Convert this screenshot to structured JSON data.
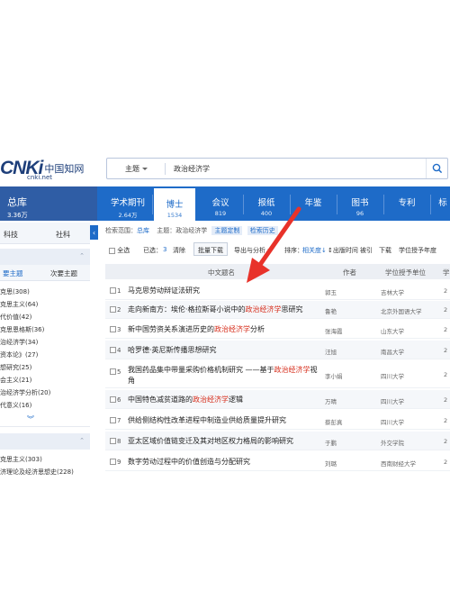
{
  "header": {
    "logo_text": "CNKi",
    "logo_cn": "中国知网",
    "logo_url": "cnki.net",
    "search_field": "主题",
    "search_value": "政治经济学"
  },
  "zongku": {
    "title": "总库",
    "count": "3.36万"
  },
  "nav_tabs": [
    {
      "label": "学术期刊",
      "count": "2.64万"
    },
    {
      "label": "博士",
      "count": "1534"
    },
    {
      "label": "会议",
      "count": "819"
    },
    {
      "label": "报纸",
      "count": "400"
    },
    {
      "label": "年鉴",
      "count": ""
    },
    {
      "label": "图书",
      "count": "96"
    },
    {
      "label": "专利",
      "count": ""
    },
    {
      "label": "标",
      "count": ""
    }
  ],
  "left": {
    "tabs": [
      "科技",
      "社科"
    ],
    "panel1_tabs": [
      "要主题",
      "次要主题"
    ],
    "panel1_items": [
      "克思(308)",
      "克思主义(64)",
      "代价值(42)",
      "克思恩格斯(36)",
      "治经济学(34)",
      "资本论》(27)",
      "想研究(25)",
      "会主义(21)",
      "治经济学分析(20)",
      "代意义(16)"
    ],
    "more_icon": "chevron-double-down",
    "panel2_items": [
      "克思主义(303)",
      "济理论及经济思想史(228)"
    ]
  },
  "results": {
    "scope_label": "检索范围：",
    "scope_value": "总库",
    "topic_label": "主题：",
    "topic_value": "政治经济学",
    "tag_custom": "主题定制",
    "tag_history": "检索历史",
    "select_all": "全选",
    "selected_label": "已选：",
    "selected_count": "3",
    "clear": "清除",
    "bulk_download": "批量下载",
    "export": "导出与分析",
    "sort_label": "排序：",
    "sort_relevance": "相关度",
    "sort_date": "出版时间",
    "sort_cited": "被引",
    "sort_download": "下载",
    "sort_unit": "学位授予年度"
  },
  "table": {
    "columns": [
      "中文题名",
      "作者",
      "学位授予单位",
      "学"
    ],
    "rows": [
      {
        "num": "1",
        "title_pre": "马克思劳动辩证法研究",
        "hl": "",
        "title_post": "",
        "author": "郭玉",
        "unit": "吉林大学",
        "extra": "2"
      },
      {
        "num": "2",
        "title_pre": "走向新南方：埃伦·格拉斯哥小说中的",
        "hl": "政治经济学",
        "title_post": "思研究",
        "author": "鲁艳",
        "unit": "北京外国语大学",
        "extra": "2"
      },
      {
        "num": "3",
        "title_pre": "新中国劳资关系演进历史的",
        "hl": "政治经济学",
        "title_post": "分析",
        "author": "张海霞",
        "unit": "山东大学",
        "extra": "2"
      },
      {
        "num": "4",
        "title_pre": "哈罗德·英尼斯传播思想研究",
        "hl": "",
        "title_post": "",
        "author": "汪旭",
        "unit": "南昌大学",
        "extra": "2"
      },
      {
        "num": "5",
        "title_pre": "我国药品集中带量采购价格机制研究 ——基于",
        "hl": "政治经济学",
        "title_post": "视角",
        "author": "李小娟",
        "unit": "四川大学",
        "extra": "2"
      },
      {
        "num": "6",
        "title_pre": "中国特色减贫道路的",
        "hl": "政治经济学",
        "title_post": "逻辑",
        "author": "万晴",
        "unit": "四川大学",
        "extra": "2"
      },
      {
        "num": "7",
        "title_pre": "供给侧结构性改革进程中制造业供给质量提升研究",
        "hl": "",
        "title_post": "",
        "author": "蔡彭真",
        "unit": "四川大学",
        "extra": "2"
      },
      {
        "num": "8",
        "title_pre": "亚太区域价值链变迁及其对地区权力格局的影响研究",
        "hl": "",
        "title_post": "",
        "author": "于鹏",
        "unit": "外交学院",
        "extra": "2"
      },
      {
        "num": "9",
        "title_pre": "数字劳动过程中的价值创造与分配研究",
        "hl": "",
        "title_post": "",
        "author": "刘璐",
        "unit": "西南财经大学",
        "extra": "2"
      }
    ]
  },
  "colors": {
    "brand_blue": "#1e6bc8",
    "highlight_red": "#d62c1a",
    "arrow_red": "#e8322a"
  }
}
